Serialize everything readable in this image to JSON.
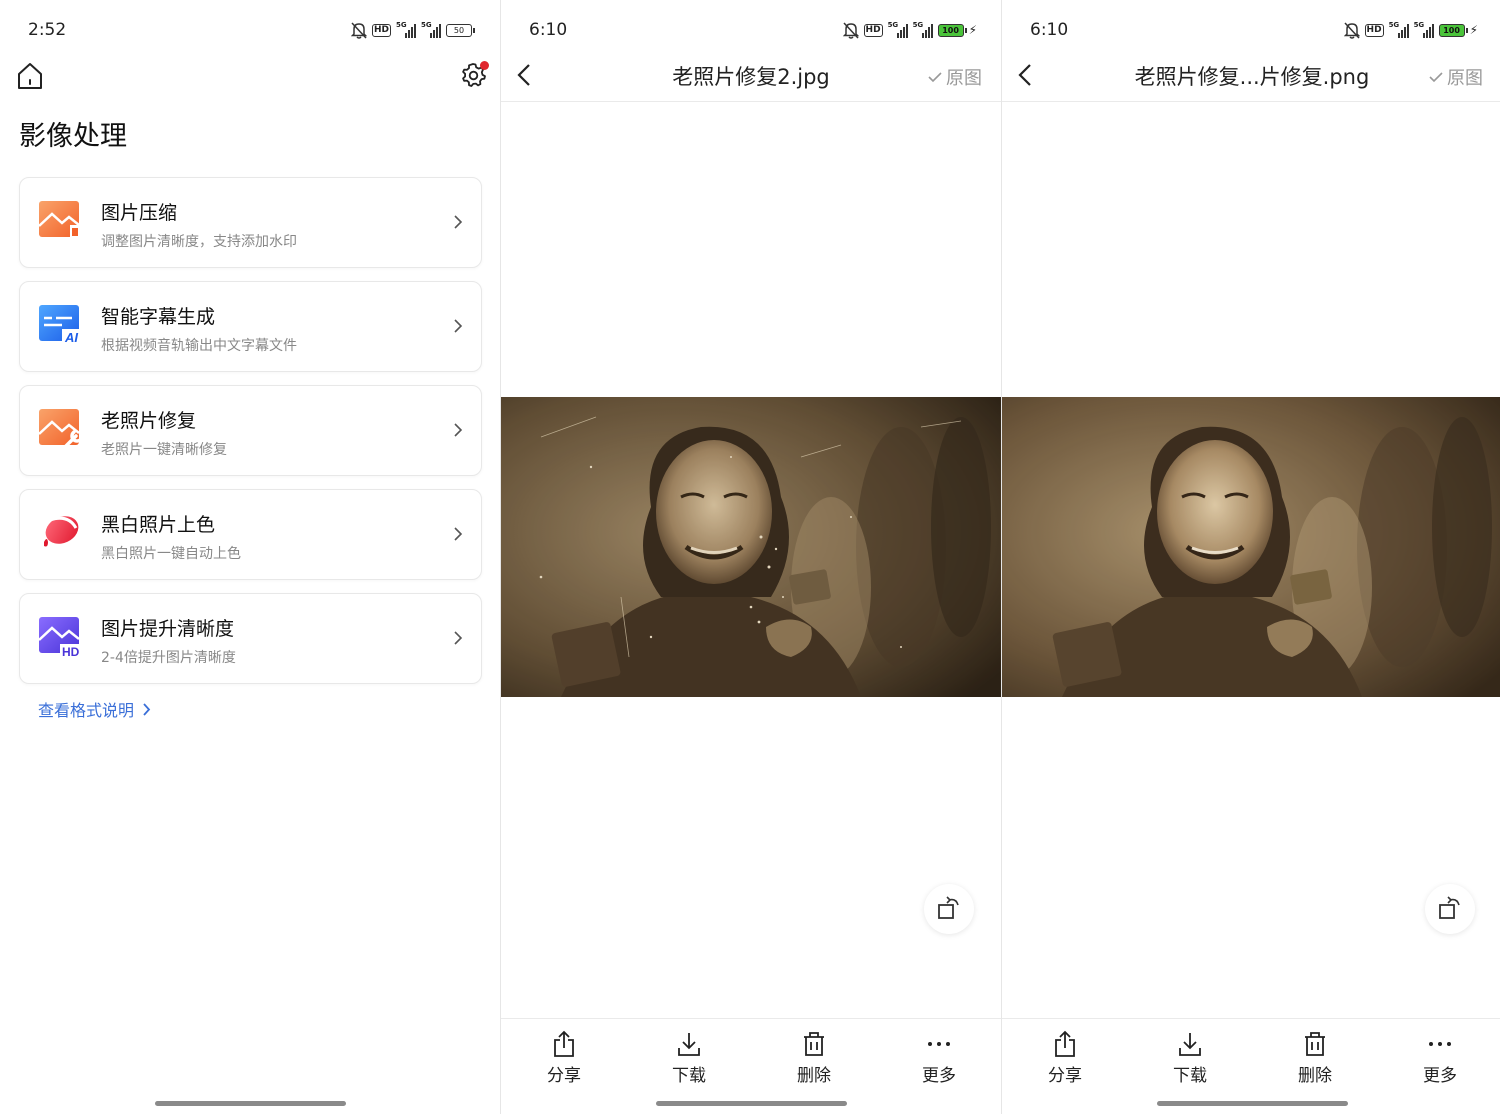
{
  "panel_left": {
    "status": {
      "time": "2:52",
      "battery": "50"
    },
    "title": "影像处理",
    "cards": [
      {
        "title": "图片压缩",
        "subtitle": "调整图片清晰度，支持添加水印",
        "icon": "image-compress-icon"
      },
      {
        "title": "智能字幕生成",
        "subtitle": "根据视频音轨输出中文字幕文件",
        "icon": "ai-subtitle-icon"
      },
      {
        "title": "老照片修复",
        "subtitle": "老照片一键清晰修复",
        "icon": "photo-repair-icon"
      },
      {
        "title": "黑白照片上色",
        "subtitle": "黑白照片一键自动上色",
        "icon": "colorize-icon"
      },
      {
        "title": "图片提升清晰度",
        "subtitle": "2-4倍提升图片清晰度",
        "icon": "hd-enhance-icon"
      }
    ],
    "format_link": "查看格式说明"
  },
  "viewer_before": {
    "status": {
      "time": "6:10",
      "battery": "100"
    },
    "filename": "老照片修复2.jpg",
    "original_label": "原图"
  },
  "viewer_after": {
    "status": {
      "time": "6:10",
      "battery": "100"
    },
    "filename": "老照片修复...片修复.png",
    "original_label": "原图"
  },
  "toolbar": {
    "share": "分享",
    "download": "下载",
    "delete": "删除",
    "more": "更多"
  },
  "colors": {
    "accent": "#3a6fd8",
    "notification": "#e0262e",
    "battery_charging": "#4ac43a"
  }
}
